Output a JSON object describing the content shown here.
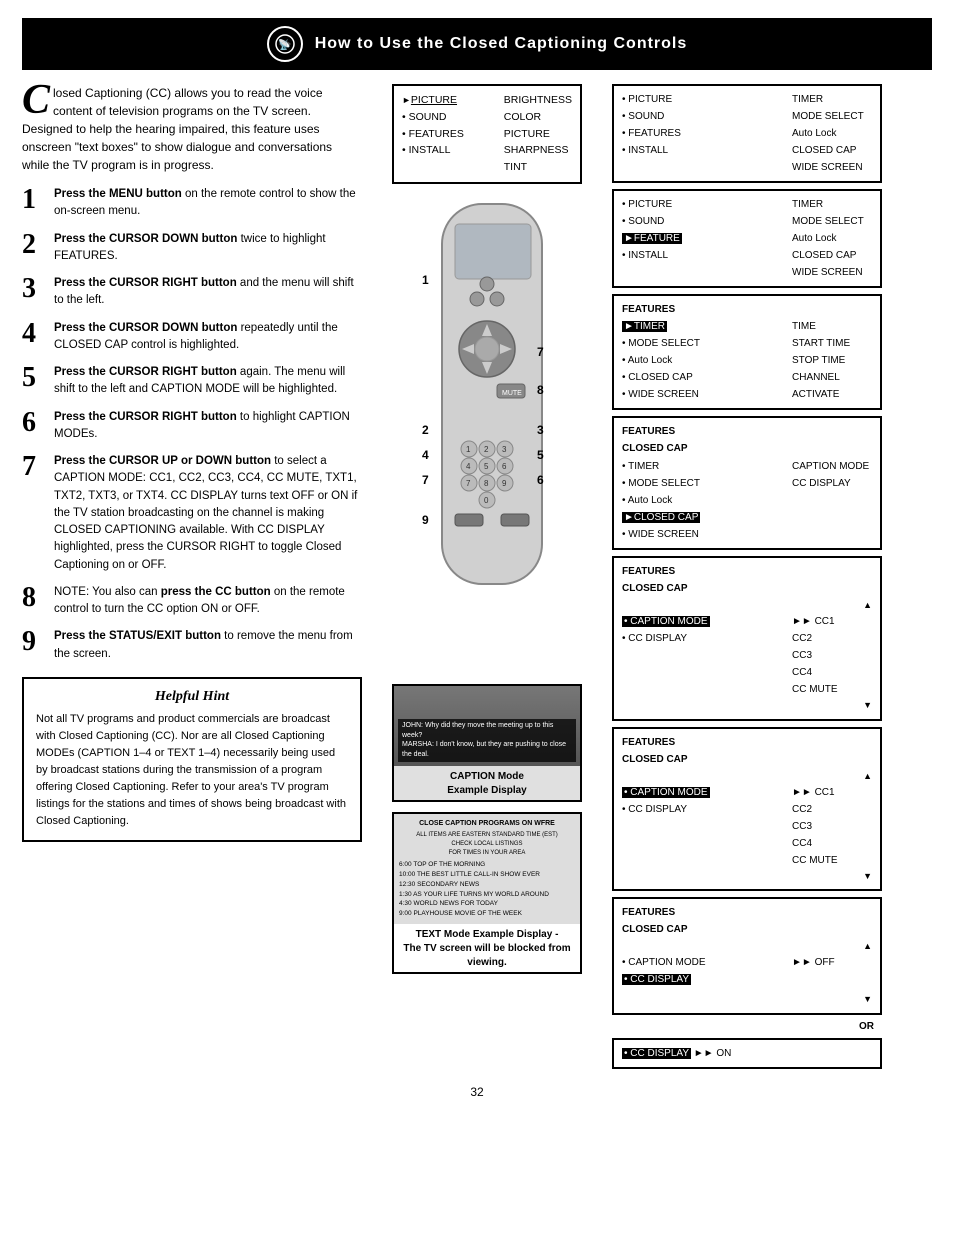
{
  "header": {
    "title": "How to Use the Closed Captioning Controls"
  },
  "intro": {
    "drop_cap": "C",
    "text": "losed Captioning (CC) allows you to read the voice content of television programs on the TV screen. Designed to help the hearing impaired, this feature uses onscreen \"text boxes\" to show dialogue and conversations while the TV program is in progress."
  },
  "steps": [
    {
      "num": "1",
      "text_strong": "Press the MENU button",
      "text": " on the remote control to show the on-screen menu."
    },
    {
      "num": "2",
      "text_strong": "Press the CURSOR DOWN button",
      "text": " twice to highlight FEATURES."
    },
    {
      "num": "3",
      "text_strong": "Press the CURSOR RIGHT button",
      "text": " and the menu will shift to the left."
    },
    {
      "num": "4",
      "text_strong": "Press the CURSOR DOWN button",
      "text": " repeatedly until the CLOSED CAP control is highlighted."
    },
    {
      "num": "5",
      "text_strong": "Press the CURSOR RIGHT button",
      "text": " again. The menu will shift to the left and CAPTION MODE will be highlighted."
    },
    {
      "num": "6",
      "text_strong": "Press the CURSOR RIGHT button",
      "text": " to highlight CAPTION MODEs."
    },
    {
      "num": "7",
      "text_strong": "Press the CURSOR UP or DOWN button",
      "text": " to select a CAPTION MODE: CC1, CC2, CC3, CC4, CC MUTE, TXT1, TXT2, TXT3, or TXT4.  CC DISPLAY turns text OFF or ON if the TV station broadcasting on the channel is making CLOSED CAPTIONING available. With CC DISPLAY highlighted, press the CURSOR RIGHT to toggle Closed Captioning on or OFF."
    },
    {
      "num": "8",
      "text_before": "NOTE: You also can ",
      "text_strong": "press the CC button",
      "text": " on the remote control to turn the CC option ON or OFF."
    },
    {
      "num": "9",
      "text_strong": "Press the STATUS/EXIT button",
      "text": " to remove the menu from the screen."
    }
  ],
  "hint": {
    "title": "Helpful Hint",
    "text": "Not all TV programs and product commercials are broadcast with Closed Captioning (CC).  Nor are all Closed Captioning MODEs (CAPTION 1–4 or TEXT 1–4) necessarily being used by broadcast stations during the transmission of a program offering Closed Captioning.  Refer to your area's TV program listings for the stations and times of shows being broadcast with Closed Captioning."
  },
  "caption_example": {
    "label_line1": "CAPTION Mode",
    "label_line2": "Example Display",
    "caption_line1": "JOHN: Why did they move the meeting up to this week?",
    "caption_line2": "MARSHA: I don't know, but they are pushing to close the deal."
  },
  "text_mode": {
    "label_bold": "TEXT  Mode Example Display -",
    "label_sub": "The TV screen will be blocked from viewing.",
    "title": "CLOSE CAPTION PROGRAMS ON WFRE",
    "subtext": "ALL ITEMS ARE EASTERN STANDARD TIME (EST)\nCHECK LOCAL LISTINGS\nFOR TIMES IN YOUR AREA",
    "items": [
      "6:00   TOP OF THE MORNING",
      "10:00  THE BEST LITTLE CALL-IN SHOW EVER",
      "12:30  SECONDARY NEWS",
      "1:30   AS YOUR LIFE TURNS MY WORLD AROUND",
      "4:30   WORLD NEWS FOR TODAY",
      "9:00   PLAYHOUSE MOVIE OF THE WEEK"
    ]
  },
  "menu_panel1": {
    "title": "",
    "rows_left": [
      "►PICTURE",
      "• SOUND",
      "• FEATURES",
      "• INSTALL"
    ],
    "rows_right": [
      "BRIGHTNESS",
      "COLOR",
      "PICTURE",
      "SHARPNESS",
      "TINT"
    ]
  },
  "menu_panel2": {
    "title": "",
    "rows_left": [
      "• PICTURE",
      "• SOUND",
      "►FEATURE",
      "• INSTALL"
    ],
    "rows_right": [
      "TIMER",
      "MODE SELECT",
      "Auto Lock",
      "CLOSED CAP",
      "WIDE SCREEN"
    ],
    "highlighted_left": "►FEATURE"
  },
  "menu_panel3": {
    "title": "FEATURES",
    "rows_left": [
      "►TIMER",
      "• MODE SELECT",
      "• Auto Lock",
      "• CLOSED CAP",
      "• WIDE SCREEN"
    ],
    "rows_right": [
      "TIME",
      "START TIME",
      "STOP TIME",
      "CHANNEL",
      "ACTIVATE"
    ],
    "highlighted_left": "►TIMER"
  },
  "menu_panel4": {
    "title": "FEATURES",
    "sub": "CLOSED CAP",
    "rows_left": [
      "• TIMER",
      "• MODE SELECT",
      "• Auto Lock",
      "►CLOSED CAP",
      "• WIDE SCREEN"
    ],
    "rows_right": [
      "CAPTION MODE",
      "CC DISPLAY"
    ],
    "highlighted_left": "►CLOSED CAP"
  },
  "menu_panel5": {
    "title": "FEATURES",
    "sub": "CLOSED CAP",
    "rows_left": [
      "• TIMER",
      "• MODE SELECT",
      "• Auto Lock",
      "►CLOSED CAP",
      "• WIDE SCREEN"
    ],
    "rows_right": [
      "CAPTION MODE",
      "CC DISPLAY"
    ],
    "highlighted_left": "►CLOSED CAP",
    "up_arrow": true
  },
  "menu_panel6": {
    "title": "FEATURES",
    "sub": "CLOSED CAP",
    "rows_left": [
      "• CAPTION MODE",
      "• CC DISPLAY"
    ],
    "rows_right": [
      "►CC1",
      "CC2",
      "CC3",
      "CC4",
      "CC MUTE"
    ],
    "highlighted_right": "►CC1",
    "has_arrows": true
  },
  "menu_panel7": {
    "title": "FEATURES",
    "sub": "CLOSED CAP",
    "rows_left": [
      "• CAPTION MODE",
      "• CC DISPLAY"
    ],
    "rows_right": [
      "►CC1",
      "CC2",
      "CC3",
      "CC4",
      "CC MUTE"
    ],
    "highlighted_right": "►CC1",
    "has_arrows": true
  },
  "menu_panel8": {
    "title": "FEATURES",
    "sub": "CLOSED CAP",
    "rows_left": [
      "• CAPTION MODE",
      "• CC DISPLAY"
    ],
    "rows_right": [
      "►CC1",
      "CC2",
      "CC3",
      "CC4",
      "CC MUTE"
    ],
    "highlighted_right": "►CC1",
    "has_arrows": true,
    "cc_display_off": true
  },
  "menu_panel_bottom": {
    "title": "FEATURES",
    "sub": "CLOSED CAP",
    "rows_left": [
      "• CAPTION MODE",
      "• CC DISPLAY"
    ],
    "rows_right": [
      "►CC1",
      "CC2",
      "CC3",
      "CC4",
      "CC MUTE"
    ],
    "highlighted_right": "►CC1",
    "has_arrows": true,
    "cc_display_on": true
  },
  "or_label": "OR",
  "cc_display_on_row": "• CC DISPLAY    ►► ON",
  "page_number": "32"
}
